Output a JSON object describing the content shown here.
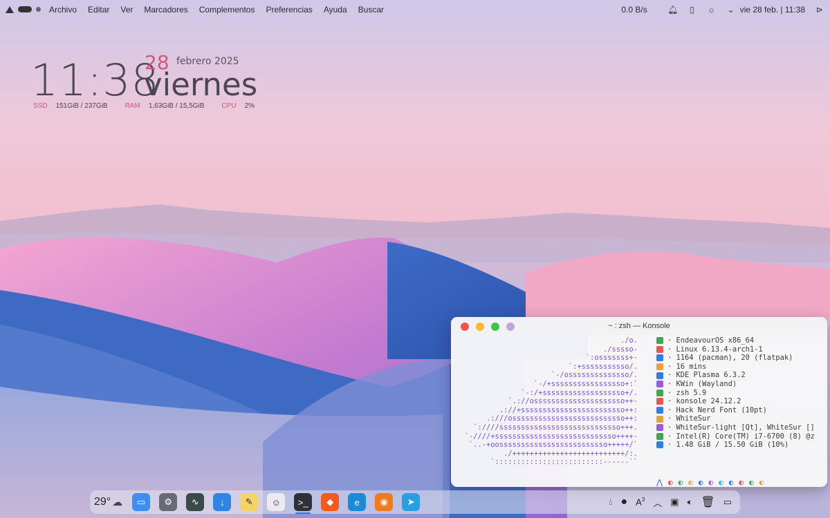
{
  "menubar": {
    "menus": [
      "Archivo",
      "Editar",
      "Ver",
      "Marcadores",
      "Complementos",
      "Preferencias",
      "Ayuda",
      "Buscar"
    ],
    "net_speed": "0.0 B/s",
    "datetime": "vie 28 feb. | 11:38"
  },
  "clock_widget": {
    "time": "11:38",
    "day": "28",
    "month_year": "febrero 2025",
    "weekday": "viernes",
    "stats": [
      {
        "label": "SSD",
        "value": "151GiB / 237GiB"
      },
      {
        "label": "RAM",
        "value": "1,63GiB / 15,5GiB"
      },
      {
        "label": "CPU",
        "value": "2%"
      }
    ]
  },
  "konsole": {
    "title": "~ : zsh — Konsole",
    "art": [
      "./o.",
      "./sssso-",
      "`:osssssss+-",
      "`:+sssssssssso/.",
      "`-/ossssssssssssso/.",
      "`-/+sssssssssssssssso+:`",
      "`-:/+sssssssssssssssssso+/.",
      "`.://osssssssssssssssssssso++-",
      ".://+ssssssssssssssssssssssso++:",
      ".:///ossssssssssssssssssssssssso++:",
      "`:////ssssssssssssssssssssssssssso+++.",
      "`-////+ssssssssssssssssssssssssssso++++-",
      "`..-+oosssssssssssssssssssssssso+++++/`",
      "./++++++++++++++++++++++++++/:.",
      "`:::::::::::::::::::::::::------``"
    ],
    "info": [
      {
        "icon": "endeavour-icon",
        "color": "#3aa856",
        "text": "EndeavourOS x86_64"
      },
      {
        "icon": "linux-icon",
        "color": "#e05a4e",
        "text": "Linux 6.13.4-arch1-1"
      },
      {
        "icon": "package-icon",
        "color": "#2f7fe0",
        "text": "1164 (pacman), 20 (flatpak)"
      },
      {
        "icon": "clock-icon",
        "color": "#e7a23a",
        "text": "16 mins"
      },
      {
        "icon": "desktop-icon",
        "color": "#2f7fe0",
        "text": "KDE Plasma 6.3.2"
      },
      {
        "icon": "window-icon",
        "color": "#9b5bd8",
        "text": "KWin (Wayland)"
      },
      {
        "icon": "shell-icon",
        "color": "#3aa856",
        "text": "zsh 5.9"
      },
      {
        "icon": "terminal-icon",
        "color": "#e05a4e",
        "text": "konsole 24.12.2"
      },
      {
        "icon": "font-icon",
        "color": "#2f7fe0",
        "text": "Hack Nerd Font (10pt)"
      },
      {
        "icon": "palette-icon",
        "color": "#e7a23a",
        "text": "WhiteSur"
      },
      {
        "icon": "brush-icon",
        "color": "#9b5bd8",
        "text": "WhiteSur-light [Qt], WhiteSur []"
      },
      {
        "icon": "cpu-icon",
        "color": "#3aa856",
        "text": "Intel(R) Core(TM) i7-6700 (8) @z"
      },
      {
        "icon": "memory-icon",
        "color": "#2f7fe0",
        "text": "1.48 GiB / 15.50 GiB (10%)"
      }
    ],
    "palette_colors": [
      "#3b5bd0",
      "#e0455a",
      "#3aa856",
      "#e7a23a",
      "#3b6fe0",
      "#9b5bd8",
      "#29b2c8",
      "#2f7fe0",
      "#e0455a",
      "#3aa856",
      "#e7a23a"
    ],
    "prompt": "➜  ~"
  },
  "dock": {
    "weather": "29°",
    "apps": [
      {
        "name": "files",
        "color": "#3d8ef0",
        "glyph": "▭"
      },
      {
        "name": "settings",
        "color": "#666b74",
        "glyph": "⚙"
      },
      {
        "name": "system-monitor",
        "color": "#3a4a48",
        "glyph": "∿"
      },
      {
        "name": "downloader",
        "color": "#2f85e3",
        "glyph": "↓"
      },
      {
        "name": "notes",
        "color": "#f3d36a",
        "glyph": "✎"
      },
      {
        "name": "finder",
        "color": "#eaeaf0",
        "glyph": "☺"
      },
      {
        "name": "konsole",
        "color": "#2f3136",
        "glyph": ">_"
      },
      {
        "name": "brave",
        "color": "#f25a1e",
        "glyph": "◆"
      },
      {
        "name": "edge",
        "color": "#1c8ad6",
        "glyph": "e"
      },
      {
        "name": "firefox",
        "color": "#f07b1e",
        "glyph": "◉"
      },
      {
        "name": "telegram",
        "color": "#2a9ee2",
        "glyph": "➤"
      }
    ],
    "tray_superscript": "3"
  }
}
